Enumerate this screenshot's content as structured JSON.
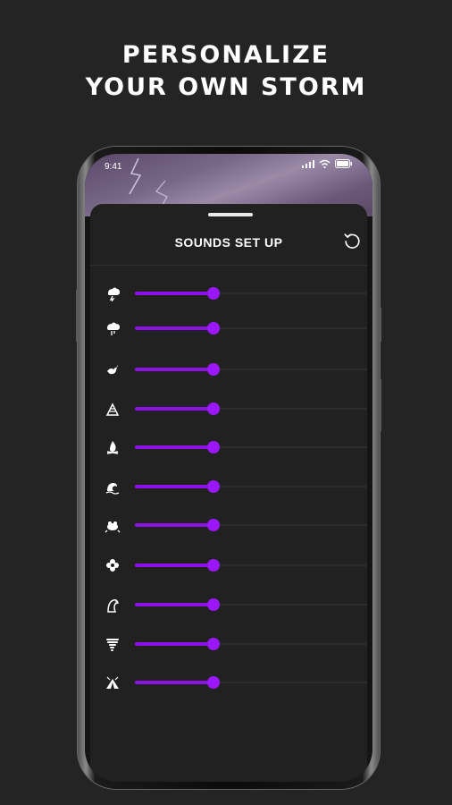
{
  "headline": {
    "line1": "PERSONALIZE",
    "line2": "YOUR OWN STORM"
  },
  "status_bar": {
    "time": "9:41"
  },
  "sheet": {
    "title": "SOUNDS SET UP"
  },
  "colors": {
    "accent": "#9a17ff",
    "background": "#242424",
    "sheet": "#212121"
  },
  "sliders": [
    {
      "icon": "thunderstorm-icon",
      "value": 0.34
    },
    {
      "icon": "rain-cloud-icon",
      "value": 0.34
    },
    {
      "icon": "bird-icon",
      "value": 0.34
    },
    {
      "icon": "crickets-icon",
      "value": 0.34
    },
    {
      "icon": "campfire-icon",
      "value": 0.34
    },
    {
      "icon": "waves-icon",
      "value": 0.34
    },
    {
      "icon": "frog-icon",
      "value": 0.34
    },
    {
      "icon": "flower-icon",
      "value": 0.34
    },
    {
      "icon": "owl-icon",
      "value": 0.34
    },
    {
      "icon": "tornado-icon",
      "value": 0.34
    },
    {
      "icon": "tent-icon",
      "value": 0.34
    }
  ]
}
